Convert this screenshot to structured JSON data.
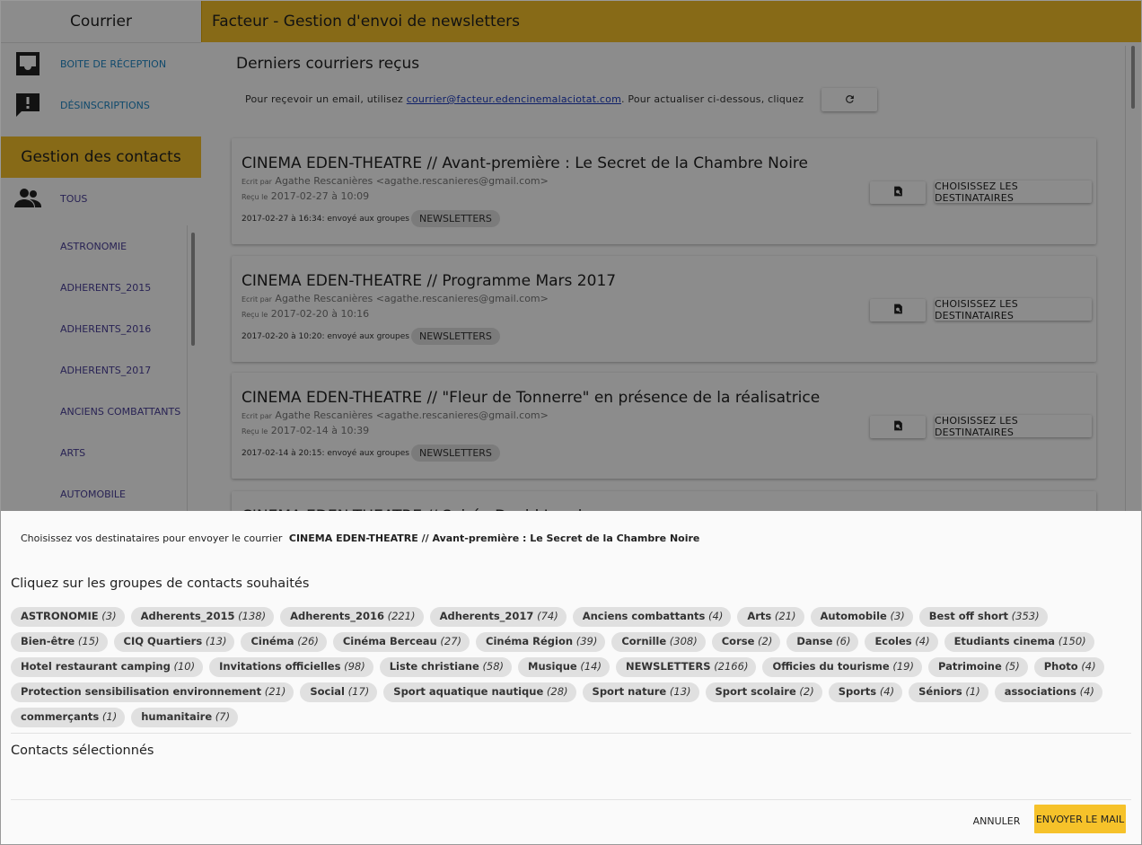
{
  "sidebar": {
    "courrier_header": "Courrier",
    "inbox_label": "BOITE DE RÉCEPTION",
    "unsubscribe_label": "DÉSINSCRIPTIONS",
    "contacts_header": "Gestion des contacts",
    "all_label": "TOUS",
    "groups": [
      "ASTRONOMIE",
      "ADHERENTS_2015",
      "ADHERENTS_2016",
      "ADHERENTS_2017",
      "ANCIENS COMBATTANTS",
      "ARTS",
      "AUTOMOBILE"
    ]
  },
  "header": {
    "title": "Facteur - Gestion d'envoi de newsletters"
  },
  "main": {
    "title": "Derniers courriers reçus",
    "info_prefix": "Pour reçevoir un email, utilisez",
    "info_email": "courrier@facteur.edencinemalaciotat.com",
    "info_suffix": ". Pour actualiser ci-dessous, cliquez",
    "written_by": "Ecrit par",
    "received_on": "Reçu le",
    "sent_to_groups": "envoyé aux groupes",
    "dest_button": "CHOISISSEZ LES DESTINATAIRES",
    "cards": [
      {
        "title": "CINEMA EDEN-THEATRE // Avant-première : Le Secret de la Chambre Noire",
        "from": "Agathe Rescanières <agathe.rescanieres@gmail.com>",
        "received": "2017-02-27 à 10:09",
        "sent": "2017-02-27 à 16:34:",
        "group": "NEWSLETTERS"
      },
      {
        "title": "CINEMA EDEN-THEATRE // Programme Mars 2017",
        "from": "Agathe Rescanières <agathe.rescanieres@gmail.com>",
        "received": "2017-02-20 à 10:16",
        "sent": "2017-02-20 à 10:20:",
        "group": "NEWSLETTERS"
      },
      {
        "title": "CINEMA EDEN-THEATRE // \"Fleur de Tonnerre\" en présence de la réalisatrice",
        "from": "Agathe Rescanières <agathe.rescanieres@gmail.com>",
        "received": "2017-02-14 à 10:39",
        "sent": "2017-02-14 à 20:15:",
        "group": "NEWSLETTERS"
      },
      {
        "title": "CINEMA EDEN-THEATRE // Soirée David Lynch",
        "from": "",
        "received": "",
        "sent": "",
        "group": ""
      }
    ]
  },
  "dialog": {
    "heading_prefix": "Choisissez vos destinataires pour envoyer le courrier",
    "heading_mail": "CINEMA EDEN-THEATRE // Avant-première : Le Secret de la Chambre Noire",
    "subtitle": "Cliquez sur les groupes de contacts souhaités",
    "selected_title": "Contacts sélectionnés",
    "cancel": "ANNULER",
    "send": "ENVOYER LE MAIL",
    "groups": [
      {
        "name": "ASTRONOMIE",
        "count": "(3)"
      },
      {
        "name": "Adherents_2015",
        "count": "(138)"
      },
      {
        "name": "Adherents_2016",
        "count": "(221)"
      },
      {
        "name": "Adherents_2017",
        "count": "(74)"
      },
      {
        "name": "Anciens combattants",
        "count": "(4)"
      },
      {
        "name": "Arts",
        "count": "(21)"
      },
      {
        "name": "Automobile",
        "count": "(3)"
      },
      {
        "name": "Best off short",
        "count": "(353)"
      },
      {
        "name": "Bien-être",
        "count": "(15)"
      },
      {
        "name": "CIQ Quartiers",
        "count": "(13)"
      },
      {
        "name": "Cinéma",
        "count": "(26)"
      },
      {
        "name": "Cinéma Berceau",
        "count": "(27)"
      },
      {
        "name": "Cinéma Région",
        "count": "(39)"
      },
      {
        "name": "Cornille",
        "count": "(308)"
      },
      {
        "name": "Corse",
        "count": "(2)"
      },
      {
        "name": "Danse",
        "count": "(6)"
      },
      {
        "name": "Ecoles",
        "count": "(4)"
      },
      {
        "name": "Etudiants cinema",
        "count": "(150)"
      },
      {
        "name": "Hotel restaurant camping",
        "count": "(10)"
      },
      {
        "name": "Invitations officielles",
        "count": "(98)"
      },
      {
        "name": "Liste christiane",
        "count": "(58)"
      },
      {
        "name": "Musique",
        "count": "(14)"
      },
      {
        "name": "NEWSLETTERS",
        "count": "(2166)"
      },
      {
        "name": "Officies du tourisme",
        "count": "(19)"
      },
      {
        "name": "Patrimoine",
        "count": "(5)"
      },
      {
        "name": "Photo",
        "count": "(4)"
      },
      {
        "name": "Protection sensibilisation environnement",
        "count": "(21)"
      },
      {
        "name": "Social",
        "count": "(17)"
      },
      {
        "name": "Sport aquatique nautique",
        "count": "(28)"
      },
      {
        "name": "Sport nature",
        "count": "(13)"
      },
      {
        "name": "Sport scolaire",
        "count": "(2)"
      },
      {
        "name": "Sports",
        "count": "(4)"
      },
      {
        "name": "Séniors",
        "count": "(1)"
      },
      {
        "name": "associations",
        "count": "(4)"
      },
      {
        "name": "commerçants",
        "count": "(1)"
      },
      {
        "name": "humanitaire",
        "count": "(7)"
      }
    ]
  },
  "colors": {
    "accent": "#f6c22a",
    "link": "#1e88c6",
    "group_link": "#4a3f99"
  },
  "icons": {
    "inbox": "inbox-icon",
    "unsubscribe": "feedback-icon",
    "contacts": "people-icon",
    "refresh": "refresh-icon",
    "preview": "find-in-page-icon"
  }
}
